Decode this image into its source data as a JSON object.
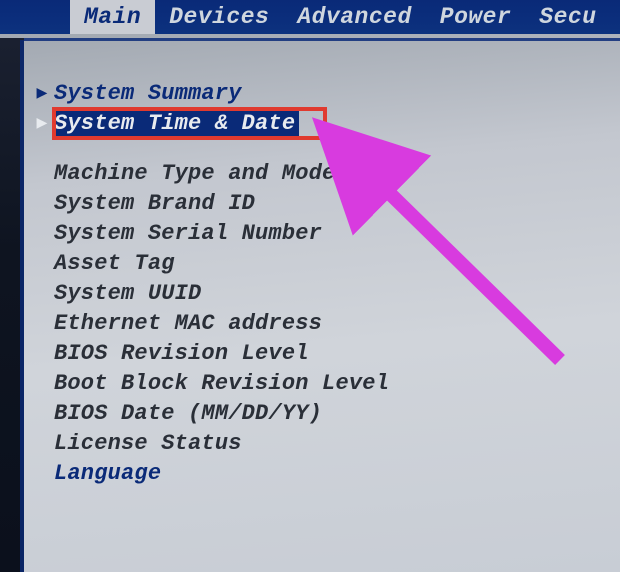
{
  "menubar": {
    "tabs": [
      {
        "label": "Main",
        "active": true
      },
      {
        "label": "Devices",
        "active": false
      },
      {
        "label": "Advanced",
        "active": false
      },
      {
        "label": "Power",
        "active": false
      },
      {
        "label": "Secu",
        "active": false
      }
    ]
  },
  "main": {
    "submenus": [
      {
        "label": "System Summary"
      },
      {
        "label": "System Time & Date",
        "selected": true
      }
    ],
    "fields": [
      {
        "label": "Machine Type and Model"
      },
      {
        "label": "System Brand ID"
      },
      {
        "label": "System Serial Number"
      },
      {
        "label": "Asset Tag"
      },
      {
        "label": "System UUID"
      },
      {
        "label": "Ethernet MAC address"
      },
      {
        "label": "BIOS Revision Level"
      },
      {
        "label": "Boot Block Revision Level"
      },
      {
        "label": "BIOS Date (MM/DD/YY)"
      },
      {
        "label": "License Status"
      },
      {
        "label": "Language",
        "link": true
      }
    ]
  },
  "annotation": {
    "highlight_color": "#e03a2f",
    "arrow_color": "#d83bdf"
  }
}
